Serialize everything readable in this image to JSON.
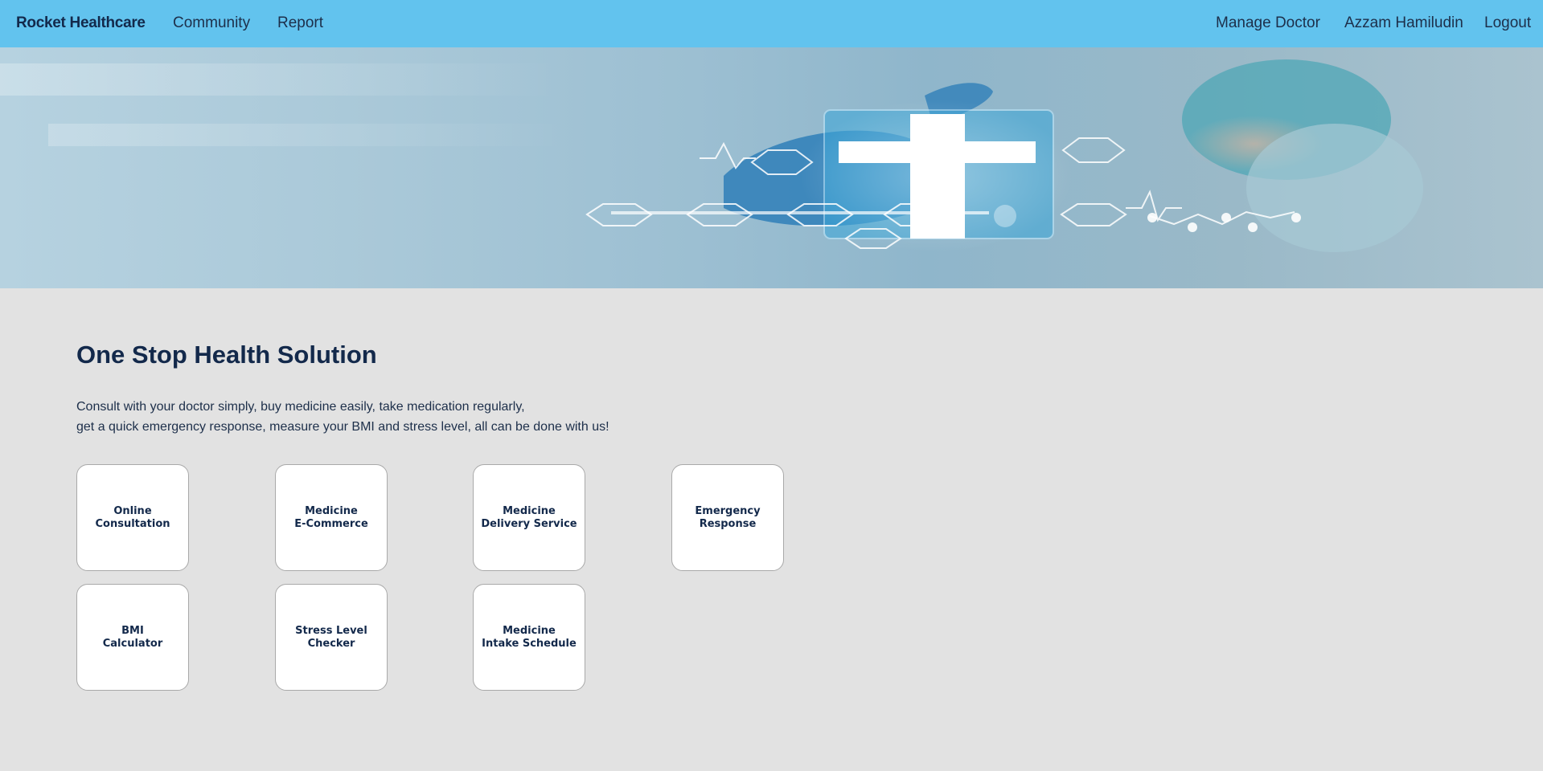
{
  "navbar": {
    "brand": "Rocket Healthcare",
    "left_links": [
      "Community",
      "Report"
    ],
    "right_links": [
      "Manage Doctor",
      "Azzam Hamiludin",
      "Logout"
    ]
  },
  "hero": {
    "image": "medical-banner-doctor-cross-icons"
  },
  "main": {
    "title": "One Stop Health Solution",
    "description_line1": "Consult with your doctor simply, buy medicine easily, take medication regularly,",
    "description_line2": "get a quick emergency response, measure your BMI and stress level, all can be done with us!",
    "cards": [
      {
        "label": "Online\nConsultation"
      },
      {
        "label": "Medicine\nE-Commerce"
      },
      {
        "label": "Medicine\nDelivery Service"
      },
      {
        "label": "Emergency\nResponse"
      },
      {
        "label": "BMI\nCalculator"
      },
      {
        "label": "Stress Level\nChecker"
      },
      {
        "label": "Medicine\nIntake Schedule"
      }
    ]
  },
  "colors": {
    "navbar": "#62c3ee",
    "page_background": "#e2e2e2",
    "heading": "#13294b",
    "card_background": "#ffffff"
  }
}
